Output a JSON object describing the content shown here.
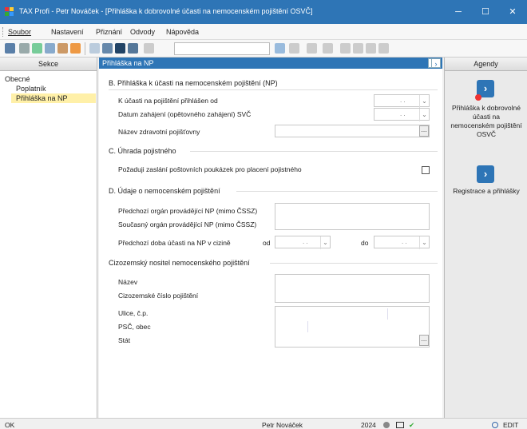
{
  "window": {
    "title": "TAX Profi - Petr Nováček - [Přihláška k dobrovolné účasti na nemocenském pojištění OSVČ]",
    "minimize": "─",
    "maximize": "☐",
    "close": "✕"
  },
  "menu": [
    "Soubor",
    "Nastavení",
    "Přiznání",
    "Odvody",
    "Nápověda"
  ],
  "left_panel": {
    "header": "Sekce",
    "items": [
      "Obecné",
      "Poplatník",
      "Přihláška na NP"
    ]
  },
  "main": {
    "header": "Přihláška na NP",
    "nav_prev": "‹",
    "nav_next": "›",
    "sections": {
      "b": {
        "title": "B. Přihláška k účasti na nemocenském pojištění (NP)",
        "label_k_ucasti": "K účasti na pojištění přihlášen od",
        "label_datum": "Datum zahájení (opětovného zahájení) SVČ",
        "label_pojistovna": "Název zdravotní pojišťovny",
        "date_placeholder": ". ."
      },
      "c": {
        "title": "C. Úhrada pojistného",
        "label_pozaduji": "Požaduji zaslání poštovních poukázek pro placení pojistného"
      },
      "d": {
        "title": "D. Údaje o nemocenském pojištění",
        "label_predchozi": "Předchozí orgán provádějící NP (mimo ČSSZ)",
        "label_soucasny": "Současný orgán provádějící NP (mimo ČSSZ)",
        "label_doba": "Předchozí doba účasti na NP v cizině",
        "label_od": "od",
        "label_do": "do",
        "date_placeholder": ". ."
      },
      "foreign": {
        "title": "Cizozemský nositel nemocenského pojištění",
        "label_nazev": "Název",
        "label_cislo": "Cizozemské číslo pojištění",
        "label_ulice": "Ulice, č.p.",
        "label_psc": "PSČ, obec",
        "label_stat": "Stát"
      }
    },
    "ellipsis": "…",
    "dropdown_arrow": "⌄"
  },
  "right_panel": {
    "header": "Agendy",
    "items": [
      {
        "label": "Přihláška k dobrovolné účasti na nemocenském pojištění OSVČ",
        "icon": "agenda-form-icon"
      },
      {
        "label": "Registrace a přihlášky",
        "icon": "agenda-registration-icon"
      }
    ]
  },
  "status": {
    "left": "OK",
    "user": "Petr Nováček",
    "year": "2024",
    "edit": "EDIT"
  },
  "colors": {
    "accent": "#2e75b6",
    "selection": "#fff0a8"
  }
}
